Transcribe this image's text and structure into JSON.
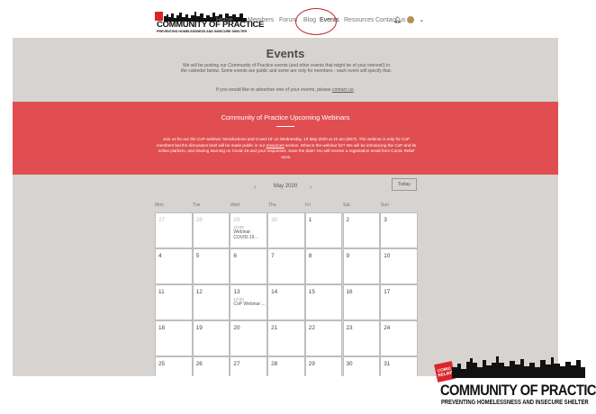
{
  "logo": {
    "line1": "COMMUNITY OF PRACTICE",
    "line2": "PREVENTING HOMELESSNESS AND INSECURE SHELTER",
    "badge": "COMIC RELIEF"
  },
  "nav": {
    "items": [
      {
        "label": "Home"
      },
      {
        "label": "Members"
      },
      {
        "label": "Forum"
      },
      {
        "label": "Blog"
      },
      {
        "label": "Events",
        "active": true
      },
      {
        "label": "Resources"
      },
      {
        "label": "Contact us"
      }
    ],
    "icons": [
      "bell-icon",
      "avatar",
      "chevron-down-icon"
    ]
  },
  "page": {
    "title": "Events",
    "intro": "We will be posting our Community of Practice events (and other events that might be of your interest!) in the calendar below. Some events are public and some are only for members - each event will specify that.",
    "advertise_text": "If you would like to advertise one of your events, please",
    "advertise_link": "contact us",
    "advertise_end": "."
  },
  "banner": {
    "title": "Community of Practice Upcoming Webinars",
    "text": "Join us for our the CoP webinar 'Introductions and Covid-19' on Wednesday, 13 May 2020 at 10 am (BST). The webinar is only for CoP members but the discussion brief will be made public in our resources section. What is the webinar for? We will be introducing the CoP and its online platform, and sharing learning on Covid-19 and your responses. Save the date! You will receive a registration email from Comic Relief soon.",
    "link_word": "resources",
    "color": "#e04e51"
  },
  "calendar": {
    "prev_icon": "‹",
    "next_icon": "›",
    "month_label": "May 2020",
    "today_label": "Today",
    "days_of_week": [
      "Mon",
      "Tue",
      "Wed",
      "Thu",
      "Fri",
      "Sat",
      "Sun"
    ],
    "weeks": [
      [
        {
          "day": "27",
          "muted": true
        },
        {
          "day": "28",
          "muted": true
        },
        {
          "day": "29",
          "muted": true,
          "time": "10:00",
          "event": "Webinar: COVID-19..."
        },
        {
          "day": "30",
          "muted": true
        },
        {
          "day": "1"
        },
        {
          "day": "2"
        },
        {
          "day": "3"
        }
      ],
      [
        {
          "day": "4"
        },
        {
          "day": "5"
        },
        {
          "day": "6"
        },
        {
          "day": "7"
        },
        {
          "day": "8"
        },
        {
          "day": "9"
        },
        {
          "day": "10"
        }
      ],
      [
        {
          "day": "11"
        },
        {
          "day": "12"
        },
        {
          "day": "13",
          "time": "10:00",
          "event": "CoP Webinar:..."
        },
        {
          "day": "14"
        },
        {
          "day": "15"
        },
        {
          "day": "16"
        },
        {
          "day": "17"
        }
      ],
      [
        {
          "day": "18"
        },
        {
          "day": "19"
        },
        {
          "day": "20"
        },
        {
          "day": "21"
        },
        {
          "day": "22"
        },
        {
          "day": "23"
        },
        {
          "day": "24"
        }
      ],
      [
        {
          "day": "25"
        },
        {
          "day": "26"
        },
        {
          "day": "27"
        },
        {
          "day": "28"
        },
        {
          "day": "29"
        },
        {
          "day": "30"
        },
        {
          "day": "31"
        }
      ]
    ]
  }
}
